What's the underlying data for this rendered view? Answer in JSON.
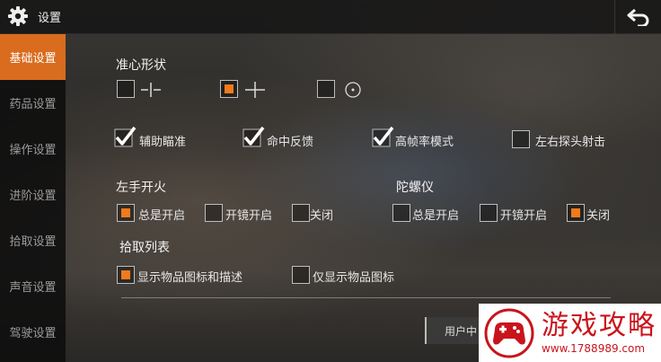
{
  "header": {
    "title": "设置",
    "settings_icon": "gear-icon",
    "back_icon": "back-arrow-icon"
  },
  "sidebar": {
    "items": [
      {
        "label": "基础设置",
        "active": true
      },
      {
        "label": "药品设置",
        "active": false
      },
      {
        "label": "操作设置",
        "active": false
      },
      {
        "label": "进阶设置",
        "active": false
      },
      {
        "label": "拾取设置",
        "active": false
      },
      {
        "label": "声音设置",
        "active": false
      },
      {
        "label": "驾驶设置",
        "active": false
      }
    ]
  },
  "crosshair": {
    "title": "准心形状",
    "options": [
      {
        "icon": "crosshair-gap-icon",
        "selected": false
      },
      {
        "icon": "crosshair-plus-icon",
        "selected": true
      },
      {
        "icon": "crosshair-circle-dot-icon",
        "selected": false
      }
    ]
  },
  "toggles": [
    {
      "label": "辅助瞄准",
      "checked": true
    },
    {
      "label": "命中反馈",
      "checked": true
    },
    {
      "label": "高帧率模式",
      "checked": true
    },
    {
      "label": "左右探头射击",
      "checked": false
    }
  ],
  "left_fire": {
    "title": "左手开火",
    "options": [
      {
        "label": "总是开启",
        "selected": true
      },
      {
        "label": "开镜开启",
        "selected": false
      },
      {
        "label": "关闭",
        "selected": false
      }
    ]
  },
  "gyroscope": {
    "title": "陀螺仪",
    "options": [
      {
        "label": "总是开启",
        "selected": false
      },
      {
        "label": "开镜开启",
        "selected": false
      },
      {
        "label": "关闭",
        "selected": true
      }
    ]
  },
  "pickup_list": {
    "title": "拾取列表",
    "options": [
      {
        "label": "显示物品图标和描述",
        "selected": true
      },
      {
        "label": "仅显示物品图标",
        "selected": false
      }
    ]
  },
  "footer": {
    "user_button_label": "用户中"
  },
  "watermark": {
    "title": "游戏攻略",
    "url": "www.1788989.com"
  },
  "colors": {
    "accent": "#f07a1e",
    "sidebar_active": "#d96c1e",
    "watermark_red": "#c9141c"
  }
}
